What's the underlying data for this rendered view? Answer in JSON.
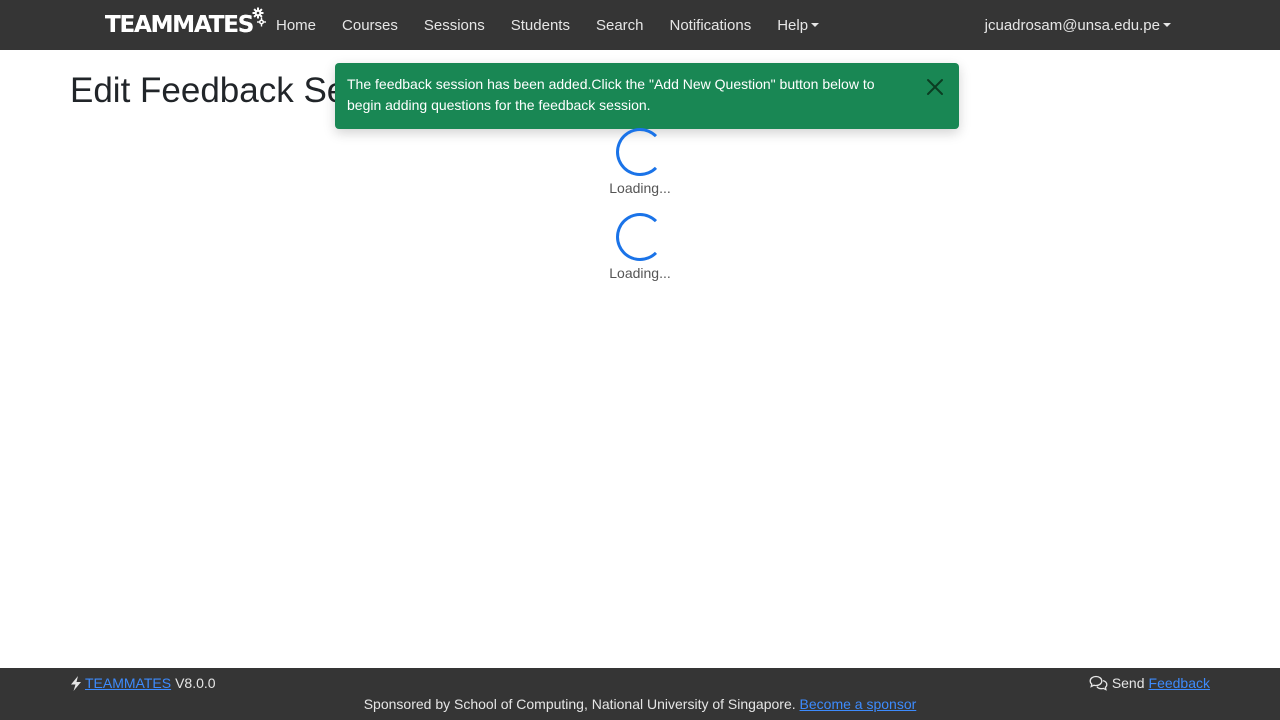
{
  "navbar": {
    "brand": "TEAMMATES",
    "items": [
      {
        "label": "Home"
      },
      {
        "label": "Courses"
      },
      {
        "label": "Sessions"
      },
      {
        "label": "Students"
      },
      {
        "label": "Search"
      },
      {
        "label": "Notifications"
      },
      {
        "label": "Help"
      }
    ],
    "user": "jcuadrosam@unsa.edu.pe"
  },
  "page": {
    "title": "Edit Feedback Session"
  },
  "toast": {
    "message": "The feedback session has been added.Click the \"Add New Question\" button below to begin adding questions for the feedback session.",
    "color": "#198754"
  },
  "loaders": [
    {
      "text": "Loading..."
    },
    {
      "text": "Loading..."
    }
  ],
  "footer": {
    "product_link": "TEAMMATES",
    "version": "V8.0.0",
    "send_prefix": "Send",
    "feedback_link": "Feedback",
    "sponsor_text": "Sponsored by School of Computing, National University of Singapore.",
    "sponsor_link": "Become a sponsor"
  },
  "colors": {
    "navbar_bg": "#353535",
    "link": "#3d8bfd",
    "spinner": "#1a73e8",
    "success": "#198754"
  }
}
